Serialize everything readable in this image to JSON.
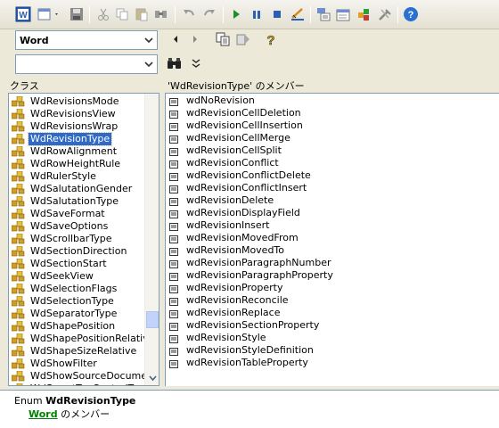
{
  "toolbar": {
    "buttons": [
      "word-app-icon",
      "back-icon",
      "save-icon",
      "cut-icon",
      "copy-icon",
      "paste-icon",
      "find-icon",
      "undo-icon",
      "redo-icon",
      "run-icon",
      "break-icon",
      "reset-icon",
      "design-mode-icon",
      "project-explorer-icon",
      "properties-icon",
      "object-browser-icon",
      "toolbox-icon",
      "help-icon"
    ]
  },
  "browser": {
    "library_value": "Word",
    "search_value": ""
  },
  "classes": {
    "header": "クラス",
    "items": [
      "WdRevisionsMode",
      "WdRevisionsView",
      "WdRevisionsWrap",
      "WdRevisionType",
      "WdRowAlignment",
      "WdRowHeightRule",
      "WdRulerStyle",
      "WdSalutationGender",
      "WdSalutationType",
      "WdSaveFormat",
      "WdSaveOptions",
      "WdScrollbarType",
      "WdSectionDirection",
      "WdSectionStart",
      "WdSeekView",
      "WdSelectionFlags",
      "WdSelectionType",
      "WdSeparatorType",
      "WdShapePosition",
      "WdShapePositionRelative",
      "WdShapeSizeRelative",
      "WdShowFilter",
      "WdShowSourceDocuments",
      "WdSmartTagControlType"
    ],
    "selected_index": 3
  },
  "members": {
    "header": "'WdRevisionType' のメンバー",
    "items": [
      "wdNoRevision",
      "wdRevisionCellDeletion",
      "wdRevisionCellInsertion",
      "wdRevisionCellMerge",
      "wdRevisionCellSplit",
      "wdRevisionConflict",
      "wdRevisionConflictDelete",
      "wdRevisionConflictInsert",
      "wdRevisionDelete",
      "wdRevisionDisplayField",
      "wdRevisionInsert",
      "wdRevisionMovedFrom",
      "wdRevisionMovedTo",
      "wdRevisionParagraphNumber",
      "wdRevisionParagraphProperty",
      "wdRevisionProperty",
      "wdRevisionReconcile",
      "wdRevisionReplace",
      "wdRevisionSectionProperty",
      "wdRevisionStyle",
      "wdRevisionStyleDefinition",
      "wdRevisionTableProperty"
    ]
  },
  "details": {
    "kind": "Enum",
    "name": "WdRevisionType",
    "library_link": "Word",
    "member_of": "のメンバー"
  },
  "colors": {
    "selection": "#316ac5",
    "link": "#008000"
  }
}
